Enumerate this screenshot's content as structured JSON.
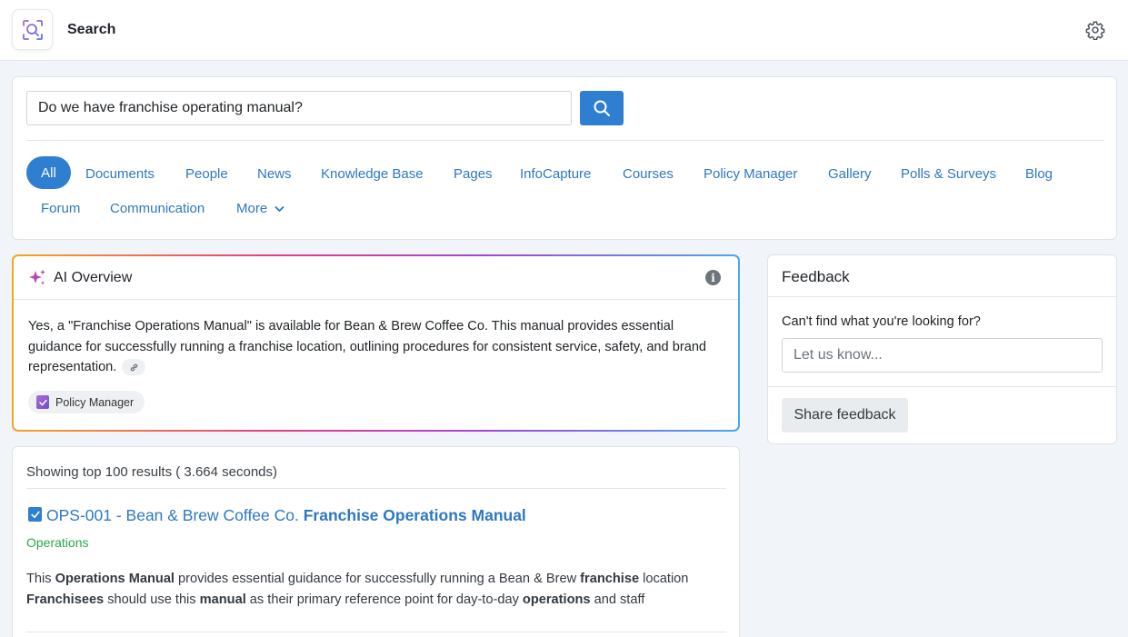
{
  "header": {
    "title": "Search",
    "logo_icon": "search-scan-icon",
    "settings_icon": "gear-icon"
  },
  "search": {
    "query": "Do we have franchise operating manual?",
    "button_icon": "search-icon",
    "accent_color": "#2f7fd1"
  },
  "tabs": [
    {
      "label": "All",
      "active": true
    },
    {
      "label": "Documents"
    },
    {
      "label": "People"
    },
    {
      "label": "News"
    },
    {
      "label": "Knowledge Base"
    },
    {
      "label": "Pages"
    },
    {
      "label": "InfoCapture"
    },
    {
      "label": "Courses"
    },
    {
      "label": "Policy Manager"
    },
    {
      "label": "Gallery"
    },
    {
      "label": "Polls & Surveys"
    },
    {
      "label": "Blog"
    },
    {
      "label": "Forum"
    },
    {
      "label": "Communication"
    },
    {
      "label": "More"
    }
  ],
  "ai_overview": {
    "title": "AI Overview",
    "text": "Yes, a \"Franchise Operations Manual\" is available for Bean & Brew Coffee Co. This manual provides essential guidance for successfully running a franchise location, outlining procedures for consistent service, safety, and brand representation.",
    "source": "Policy Manager",
    "icons": [
      "sparkle-icon",
      "info-icon",
      "link-icon",
      "policy-manager-icon"
    ]
  },
  "feedback": {
    "title": "Feedback",
    "prompt": "Can't find what you're looking for?",
    "placeholder": "Let us know...",
    "button": "Share feedback"
  },
  "results": {
    "summary": "Showing top 100 results ( 3.664 seconds)",
    "items": [
      {
        "title_plain": "OPS-001 - Bean & Brew Coffee Co. ",
        "title_bold": "Franchise Operations Manual",
        "category": "Operations",
        "snippet_lines": [
          [
            {
              "t": "This "
            },
            {
              "t": "Operations Manual",
              "b": true
            },
            {
              "t": " provides essential guidance for successfully running a Bean & Brew "
            },
            {
              "t": "franchise",
              "b": true
            },
            {
              "t": " location"
            }
          ],
          [
            {
              "t": "Franchisees",
              "b": true
            },
            {
              "t": " should use this "
            },
            {
              "t": "manual",
              "b": true
            },
            {
              "t": " as their primary reference point for day-to-day "
            },
            {
              "t": "operations",
              "b": true
            },
            {
              "t": " and staff"
            }
          ]
        ]
      }
    ]
  }
}
